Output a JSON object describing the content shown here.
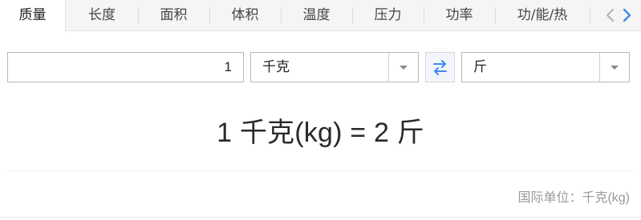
{
  "tabs": [
    {
      "label": "质量",
      "active": true
    },
    {
      "label": "长度"
    },
    {
      "label": "面积"
    },
    {
      "label": "体积"
    },
    {
      "label": "温度"
    },
    {
      "label": "压力"
    },
    {
      "label": "功率"
    },
    {
      "label": "功/能/热"
    }
  ],
  "converter": {
    "amount": "1",
    "from_unit": "千克",
    "to_unit": "斤"
  },
  "result": "1 千克(kg) = 2 斤",
  "footer": {
    "si_unit": "国际单位：千克(kg)"
  },
  "icons": {
    "prev": "chevron-left-icon",
    "next": "chevron-right-icon",
    "swap": "swap-arrows-icon",
    "dropdown": "caret-down-icon"
  },
  "colors": {
    "accent": "#3b8beb",
    "arrow_inactive": "#b5b5b5"
  }
}
